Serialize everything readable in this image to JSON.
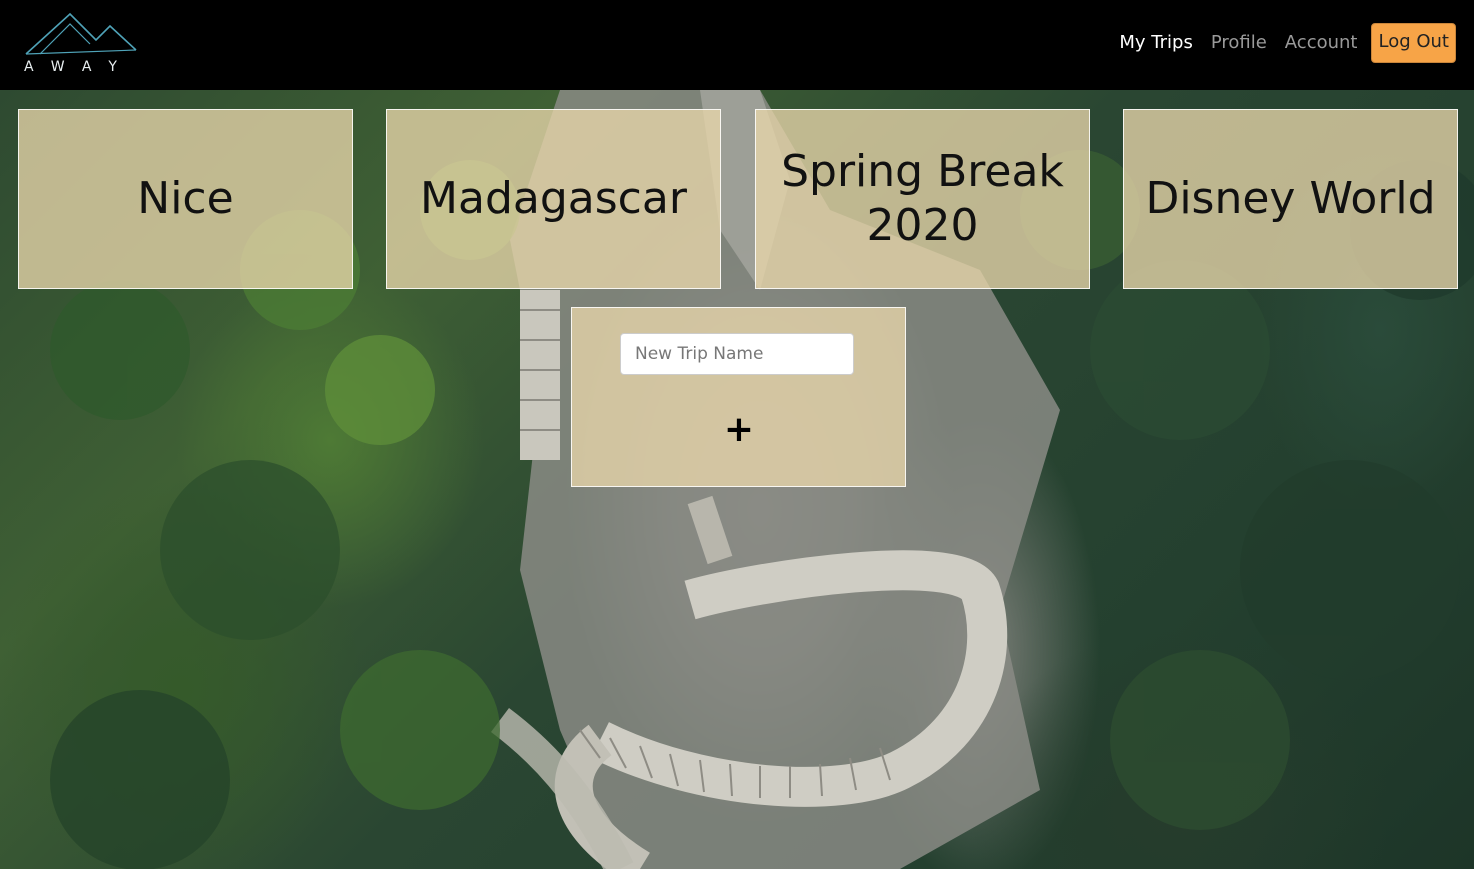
{
  "header": {
    "logo_text": "AWAY",
    "nav": [
      {
        "label": "My Trips",
        "active": true
      },
      {
        "label": "Profile",
        "active": false
      },
      {
        "label": "Account",
        "active": false
      }
    ],
    "logout_label": "Log Out"
  },
  "trips": [
    {
      "name": "Nice"
    },
    {
      "name": "Madagascar"
    },
    {
      "name": "Spring Break 2020"
    },
    {
      "name": "Disney World"
    }
  ],
  "new_trip": {
    "placeholder": "New Trip Name",
    "value": "",
    "add_label": "+"
  },
  "colors": {
    "navbar_bg": "#000000",
    "logout_bg": "#f7a447",
    "card_bg": "#e8d6aa",
    "logo_stroke": "#4fa3b8"
  },
  "icons": {
    "logo": "mountain-logo-icon",
    "add": "plus-icon"
  }
}
